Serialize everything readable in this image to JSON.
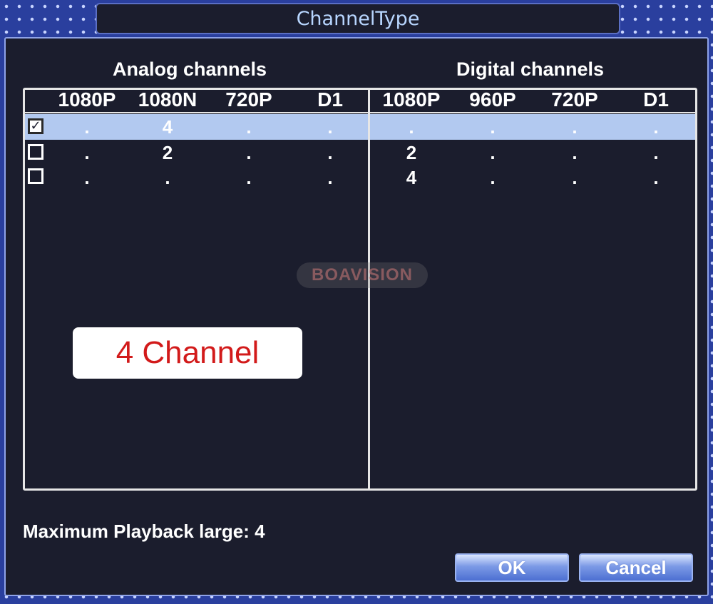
{
  "dialog": {
    "title": "ChannelType"
  },
  "analog": {
    "title": "Analog channels",
    "columns": [
      "1080P",
      "1080N",
      "720P",
      "D1"
    ],
    "rows": [
      {
        "checked": true,
        "values": [
          ".",
          "4",
          ".",
          "."
        ]
      },
      {
        "checked": false,
        "values": [
          ".",
          "2",
          ".",
          "."
        ]
      },
      {
        "checked": false,
        "values": [
          ".",
          ".",
          ".",
          "."
        ]
      }
    ]
  },
  "digital": {
    "title": "Digital channels",
    "columns": [
      "1080P",
      "960P",
      "720P",
      "D1"
    ],
    "rows": [
      {
        "values": [
          ".",
          ".",
          ".",
          "."
        ]
      },
      {
        "values": [
          "2",
          ".",
          ".",
          "."
        ]
      },
      {
        "values": [
          "4",
          ".",
          ".",
          "."
        ]
      }
    ]
  },
  "watermark": "BOAVISION",
  "overlay_label": "4 Channel",
  "playback_text": "Maximum Playback large: 4",
  "buttons": {
    "ok": "OK",
    "cancel": "Cancel"
  },
  "colors": {
    "highlight": "#b2c9f0",
    "window_bg": "#1b1d2d",
    "bezel": "#2a3f9e",
    "overlay_text": "#d21a1a"
  },
  "selected_row": 0
}
